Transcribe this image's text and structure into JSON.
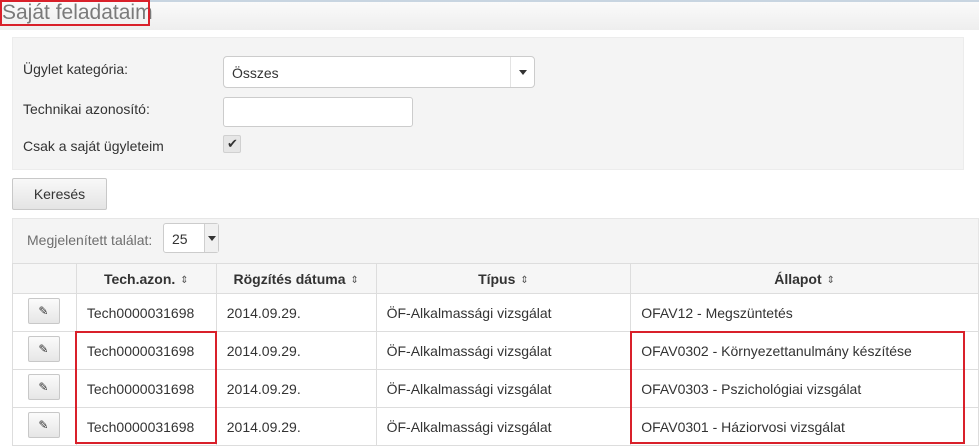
{
  "header": {
    "title": "Saját feladataim"
  },
  "filters": {
    "category_label": "Ügylet kategória:",
    "category_value": "Összes",
    "tech_id_label": "Technikai azonosító:",
    "tech_id_value": "",
    "own_only_label": "Csak a saját ügyleteim",
    "own_only_checked": true,
    "check_glyph": "✔"
  },
  "search_button": "Keresés",
  "results": {
    "count_label": "Megjelenített találat:",
    "count_value": "25",
    "sort_glyph": "⇕",
    "edit_glyph": "✎",
    "columns": [
      "",
      "Tech.azon.",
      "Rögzítés dátuma",
      "Típus",
      "Állapot"
    ],
    "rows": [
      {
        "tech_id": "Tech0000031698",
        "date": "2014.09.29.",
        "type": "ÖF-Alkalmassági vizsgálat",
        "status": "OFAV12 - Megszüntetés"
      },
      {
        "tech_id": "Tech0000031698",
        "date": "2014.09.29.",
        "type": "ÖF-Alkalmassági vizsgálat",
        "status": "OFAV0302 - Környezettanulmány készítése"
      },
      {
        "tech_id": "Tech0000031698",
        "date": "2014.09.29.",
        "type": "ÖF-Alkalmassági vizsgálat",
        "status": "OFAV0303 - Pszichológiai vizsgálat"
      },
      {
        "tech_id": "Tech0000031698",
        "date": "2014.09.29.",
        "type": "ÖF-Alkalmassági vizsgálat",
        "status": "OFAV0301 - Háziorvosi vizsgálat"
      }
    ]
  },
  "highlight_color": "#d9202a"
}
